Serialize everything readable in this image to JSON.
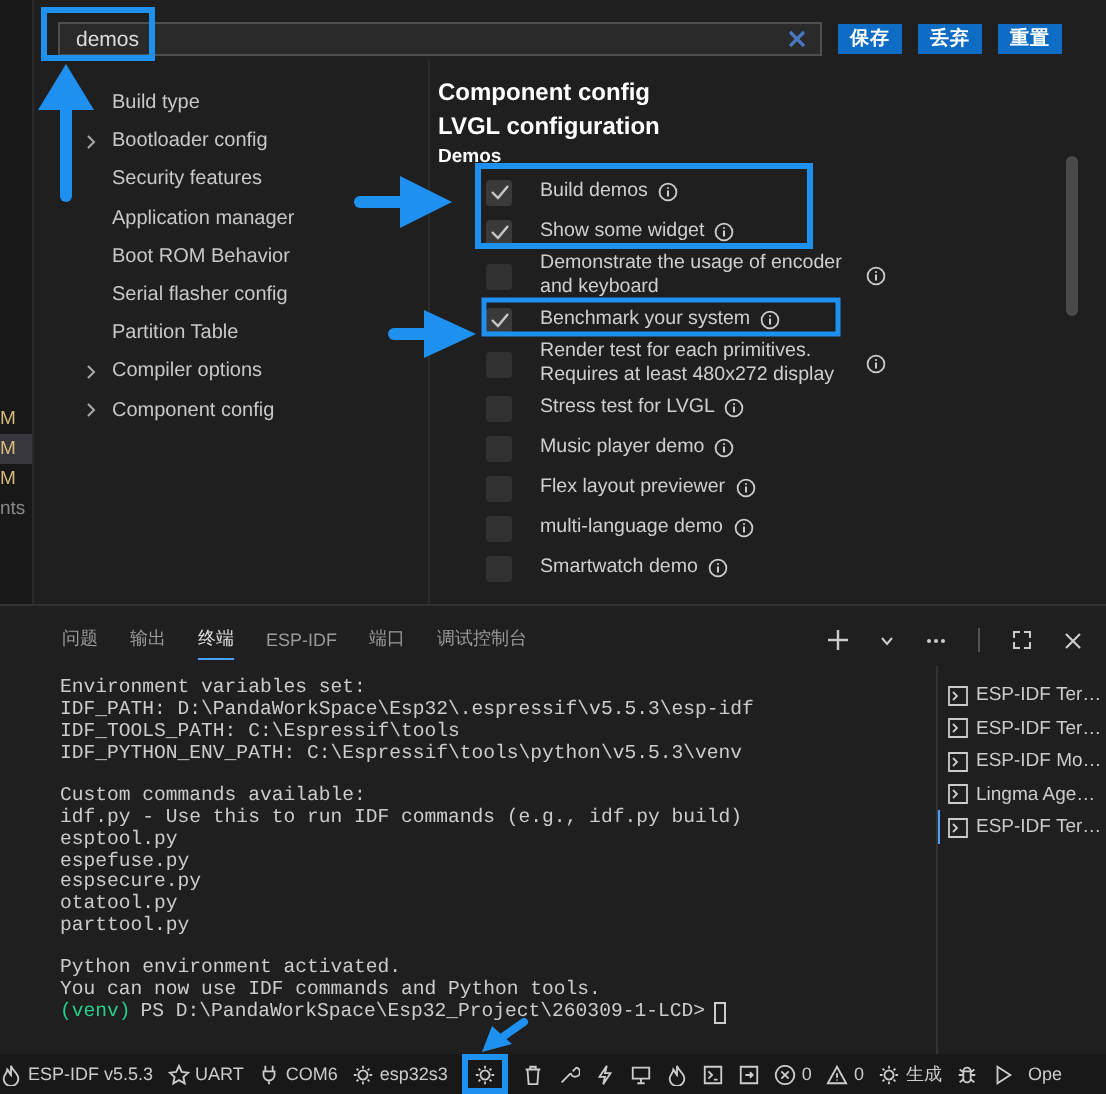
{
  "activity_fragments": [
    {
      "text": "M",
      "selected": false
    },
    {
      "text": "M",
      "selected": true
    },
    {
      "text": "M",
      "selected": false
    },
    {
      "text": "nts",
      "selected": false
    }
  ],
  "search": {
    "value": "demos"
  },
  "buttons": [
    "保存",
    "丢弃",
    "重置"
  ],
  "tree": [
    {
      "label": "Build type",
      "kind": "leaf"
    },
    {
      "label": "Bootloader config",
      "kind": "group"
    },
    {
      "label": "Security features",
      "kind": "leaf"
    },
    {
      "label": "Application manager",
      "kind": "leaf"
    },
    {
      "label": "Boot ROM Behavior",
      "kind": "leaf"
    },
    {
      "label": "Serial flasher config",
      "kind": "leaf"
    },
    {
      "label": "Partition Table",
      "kind": "leaf"
    },
    {
      "label": "Compiler options",
      "kind": "group"
    },
    {
      "label": "Component config",
      "kind": "group"
    }
  ],
  "config": {
    "headings": [
      "Component config",
      "LVGL configuration"
    ],
    "section": "Demos",
    "options": [
      {
        "label": "Build demos",
        "checked": true
      },
      {
        "label": "Show some widget",
        "checked": true
      },
      {
        "label": "Demonstrate the usage of encoder and keyboard",
        "checked": false
      },
      {
        "label": "Benchmark your system",
        "checked": true
      },
      {
        "label": "Render test for each primitives. Requires at least 480x272 display",
        "checked": false
      },
      {
        "label": "Stress test for LVGL",
        "checked": false
      },
      {
        "label": "Music player demo",
        "checked": false
      },
      {
        "label": "Flex layout previewer",
        "checked": false
      },
      {
        "label": "multi-language demo",
        "checked": false
      },
      {
        "label": "Smartwatch demo",
        "checked": false
      }
    ]
  },
  "panel_tabs": [
    {
      "label": "问题",
      "selected": false
    },
    {
      "label": "输出",
      "selected": false
    },
    {
      "label": "终端",
      "selected": true
    },
    {
      "label": "ESP-IDF",
      "selected": false
    },
    {
      "label": "端口",
      "selected": false
    },
    {
      "label": "调试控制台",
      "selected": false
    }
  ],
  "terminal": {
    "blocks": [
      [
        "Environment variables set:",
        "IDF_PATH: D:\\PandaWorkSpace\\Esp32\\.espressif\\v5.5.3\\esp-idf",
        "IDF_TOOLS_PATH: C:\\Espressif\\tools",
        "IDF_PYTHON_ENV_PATH: C:\\Espressif\\tools\\python\\v5.5.3\\venv"
      ],
      [
        "Custom commands available:",
        "idf.py - Use this to run IDF commands (e.g., idf.py build)",
        "esptool.py",
        "espefuse.py",
        "espsecure.py",
        "otatool.py",
        "parttool.py"
      ],
      [
        "Python environment activated.",
        "You can now use IDF commands and Python tools."
      ]
    ],
    "prompt_env": "(venv)",
    "prompt": "PS D:\\PandaWorkSpace\\Esp32_Project\\260309-1-LCD>"
  },
  "terminals": [
    {
      "label": "ESP-IDF Ter…",
      "selected": false
    },
    {
      "label": "ESP-IDF Ter…",
      "selected": false
    },
    {
      "label": "ESP-IDF Mo…",
      "selected": false
    },
    {
      "label": "Lingma Age…",
      "selected": false
    },
    {
      "label": "ESP-IDF Ter…",
      "selected": true
    }
  ],
  "status_bar": {
    "idf": "ESP-IDF v5.5.3",
    "port_type": "UART",
    "port": "COM6",
    "target": "esp32s3",
    "errors": "0",
    "warnings": "0",
    "build": "生成",
    "overflow": "Ope"
  }
}
